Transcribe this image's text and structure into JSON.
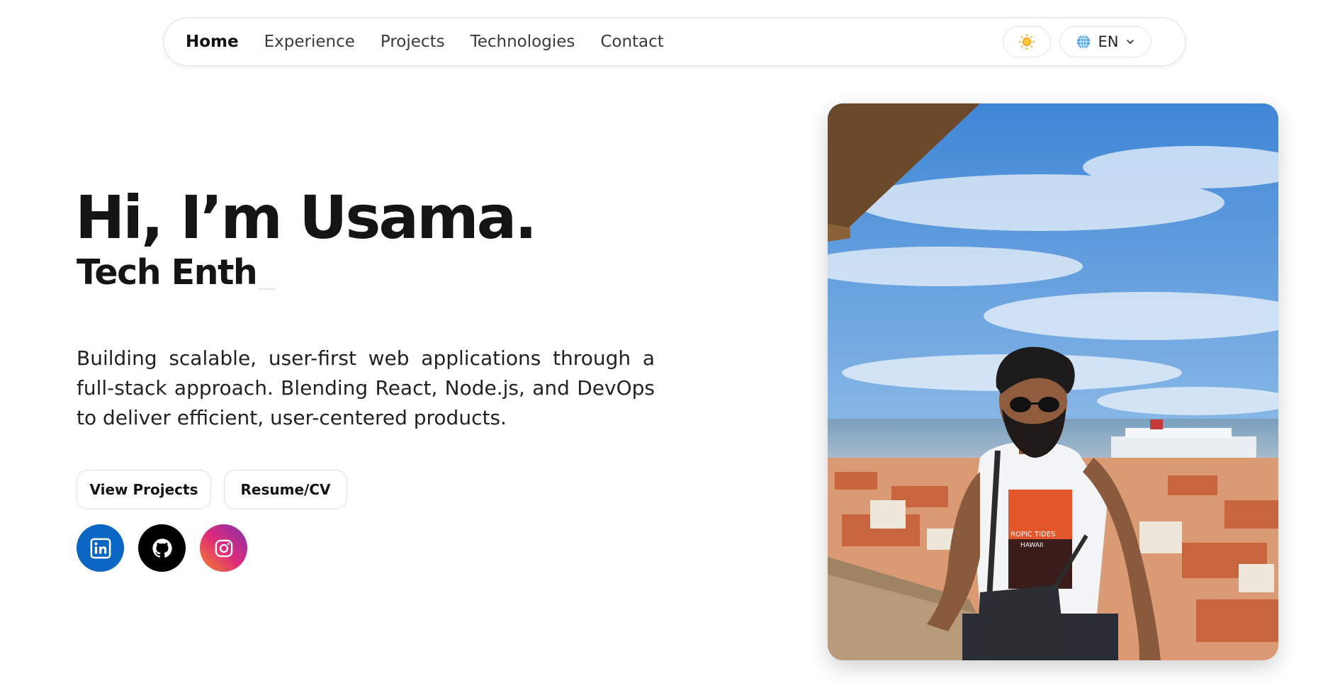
{
  "nav": {
    "links": [
      {
        "label": "Home",
        "active": true
      },
      {
        "label": "Experience",
        "active": false
      },
      {
        "label": "Projects",
        "active": false
      },
      {
        "label": "Technologies",
        "active": false
      },
      {
        "label": "Contact",
        "active": false
      }
    ],
    "theme_icon": "sun-icon",
    "language": {
      "label": "EN",
      "icon": "globe-icon",
      "caret": "chevron-down-icon"
    }
  },
  "hero": {
    "title": "Hi, I’m Usama.",
    "subtitle": "Tech Enth",
    "description": "Building scalable, user-first web applications through a full-stack approach. Blending React, Node.js, and DevOps to deliver efficient, user-centered products."
  },
  "buttons": {
    "view_projects": "View Projects",
    "resume": "Resume/CV"
  },
  "social": [
    {
      "name": "linkedin",
      "icon": "linkedin-icon",
      "color": "#0a66c2"
    },
    {
      "name": "github",
      "icon": "github-icon",
      "color": "#000000"
    },
    {
      "name": "instagram",
      "icon": "instagram-icon",
      "color": "#dd2a7b"
    }
  ],
  "photo": {
    "shirt_text_1": "ROPIC TIDES",
    "shirt_text_2": "HAWAII"
  }
}
